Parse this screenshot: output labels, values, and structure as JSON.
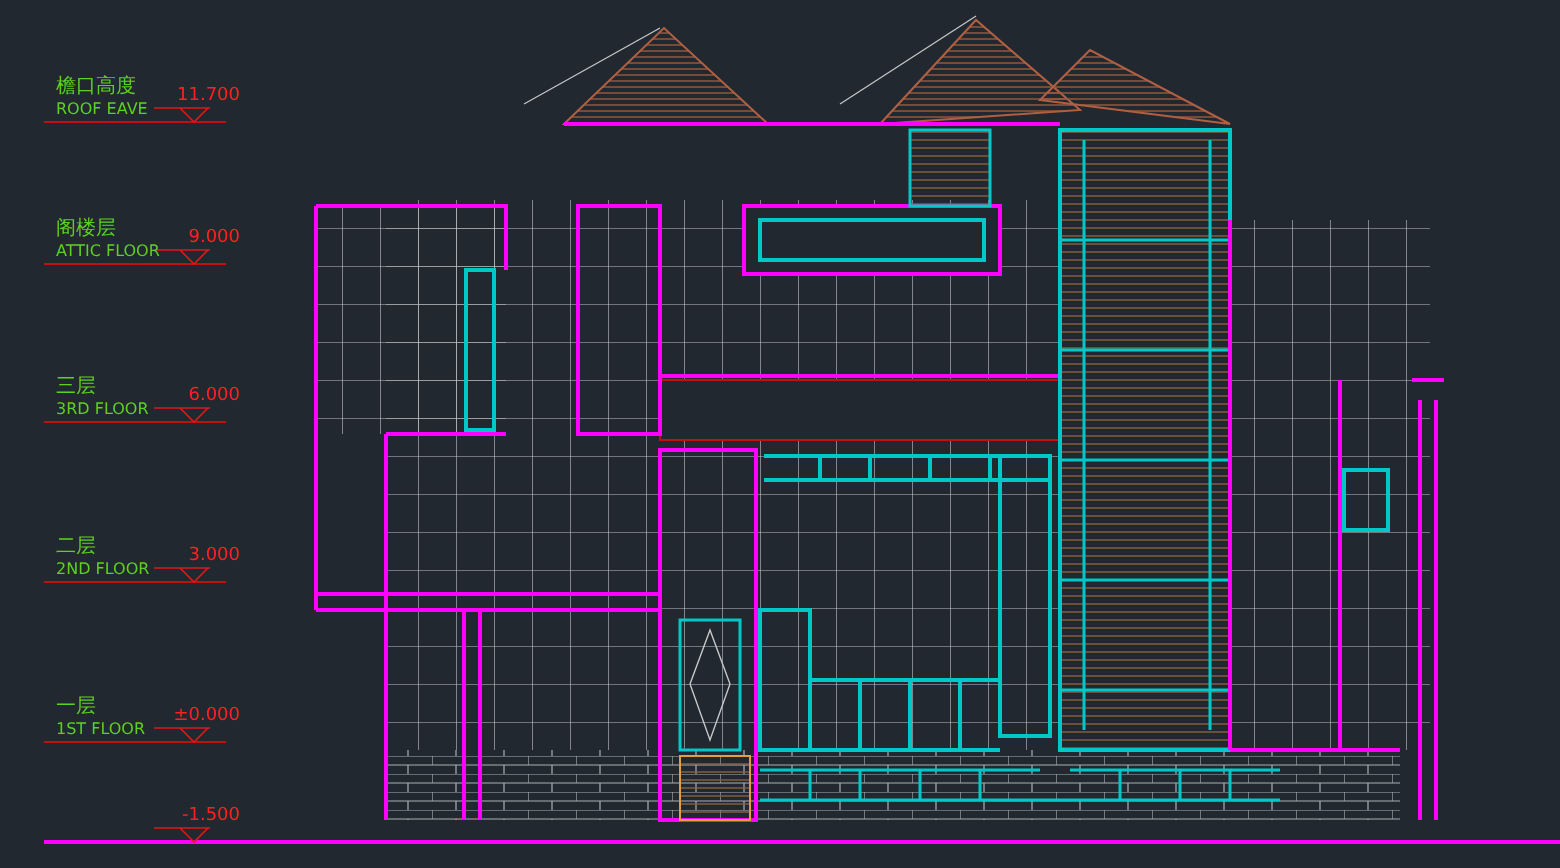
{
  "levels": [
    {
      "label_cn": "檐口高度",
      "label_en": "ROOF EAVE",
      "elevation": "11.700"
    },
    {
      "label_cn": "阁楼层",
      "label_en": "ATTIC FLOOR",
      "elevation": "9.000"
    },
    {
      "label_cn": "三层",
      "label_en": "3RD FLOOR",
      "elevation": "6.000"
    },
    {
      "label_cn": "二层",
      "label_en": "2ND FLOOR",
      "elevation": "3.000"
    },
    {
      "label_cn": "一层",
      "label_en": "1ST FLOOR",
      "elevation": "±0.000"
    },
    {
      "elevation": "-1.500"
    }
  ]
}
